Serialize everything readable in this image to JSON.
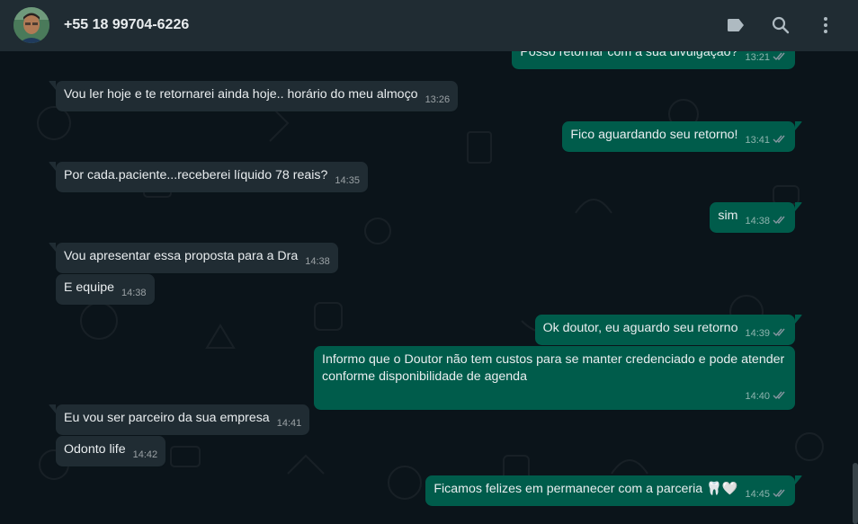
{
  "header": {
    "contact_name": "+55 18 99704-6226",
    "icons": [
      "label-icon",
      "search-icon",
      "menu-dots-icon"
    ]
  },
  "colors": {
    "header_bg": "#202c33",
    "chat_bg": "#0b141a",
    "incoming_bubble": "#202c33",
    "outgoing_bubble": "#005c4b",
    "read_ticks": "#8696a0"
  },
  "messages": [
    {
      "dir": "out",
      "text": "Posso retornar com a sua divulgação?",
      "time": "13:21"
    },
    {
      "dir": "in",
      "text": "Vou ler hoje e te retornarei ainda hoje.. horário do meu almoço",
      "time": "13:26"
    },
    {
      "dir": "out",
      "text": "Fico aguardando seu retorno!",
      "time": "13:41"
    },
    {
      "dir": "in",
      "text": "Por cada.paciente...receberei líquido 78 reais?",
      "time": "14:35"
    },
    {
      "dir": "out",
      "text": "sim",
      "time": "14:38"
    },
    {
      "dir": "in",
      "text": "Vou apresentar essa proposta para a Dra",
      "time": "14:38"
    },
    {
      "dir": "in",
      "text": "E equipe",
      "time": "14:38"
    },
    {
      "dir": "out",
      "text": "Ok doutor, eu aguardo seu retorno",
      "time": "14:39"
    },
    {
      "dir": "out",
      "text": "Informo que o Doutor não tem custos para se manter credenciado e pode atender conforme disponibilidade de agenda",
      "time": "14:40"
    },
    {
      "dir": "in",
      "text": "Eu vou ser parceiro da sua empresa",
      "time": "14:41"
    },
    {
      "dir": "in",
      "text": "Odonto life",
      "time": "14:42"
    },
    {
      "dir": "out",
      "text": "Ficamos felizes em permanecer com a parceria 🦷🤍",
      "time": "14:45"
    }
  ]
}
